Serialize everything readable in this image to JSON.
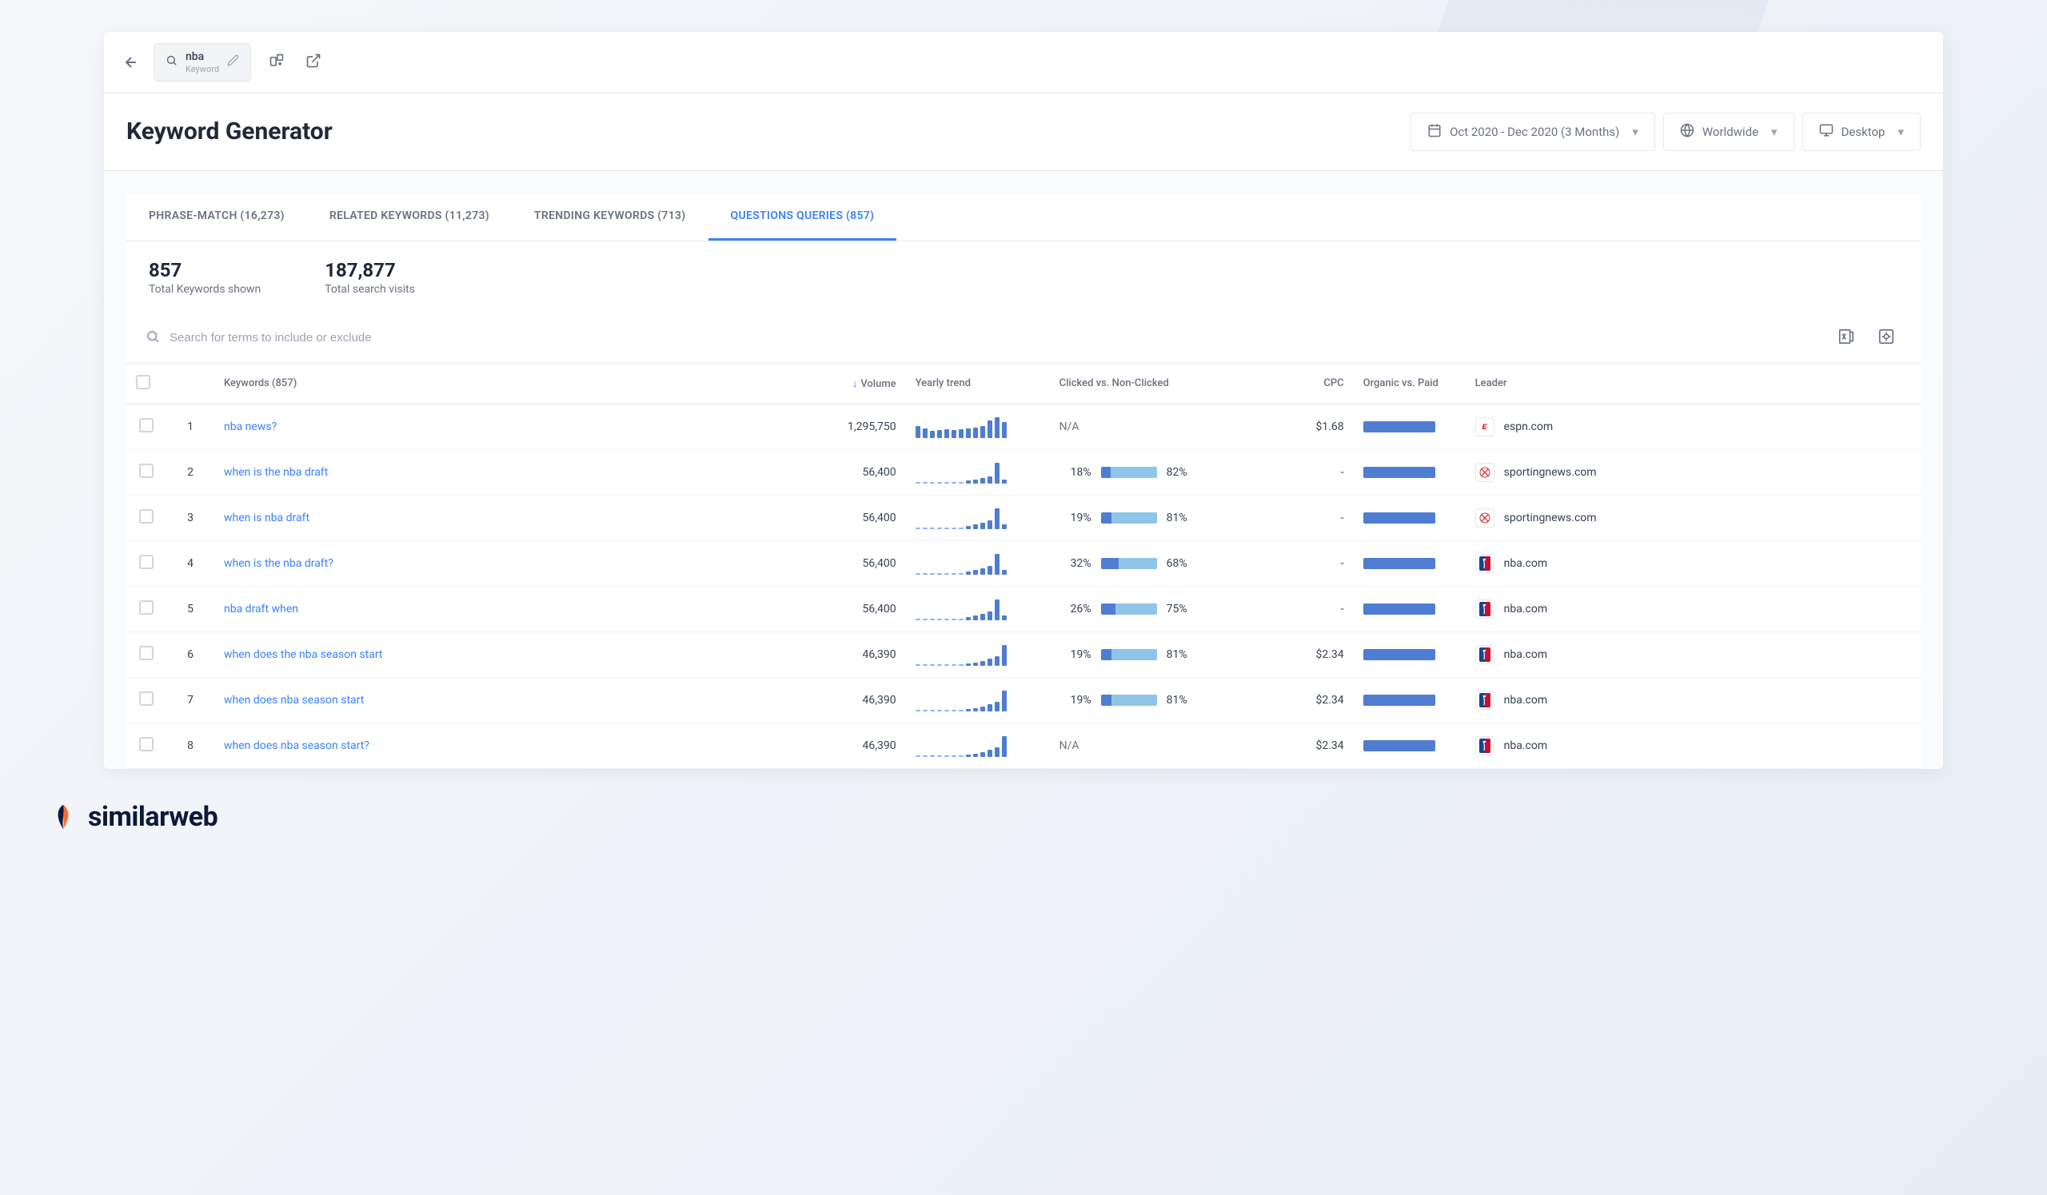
{
  "topbar": {
    "keyword_term": "nba",
    "keyword_type": "Keyword"
  },
  "header": {
    "title": "Keyword Generator",
    "date_range": "Oct 2020 - Dec 2020 (3 Months)",
    "region": "Worldwide",
    "device": "Desktop"
  },
  "tabs": [
    {
      "label": "PHRASE-MATCH (16,273)",
      "active": false
    },
    {
      "label": "RELATED KEYWORDS (11,273)",
      "active": false
    },
    {
      "label": "TRENDING KEYWORDS (713)",
      "active": false
    },
    {
      "label": "QUESTIONS QUERIES (857)",
      "active": true
    }
  ],
  "summary": {
    "total_keywords_value": "857",
    "total_keywords_label": "Total Keywords shown",
    "total_visits_value": "187,877",
    "total_visits_label": "Total search visits"
  },
  "search": {
    "placeholder": "Search for terms to include or exclude"
  },
  "columns": {
    "keywords": "Keywords (857)",
    "volume": "Volume",
    "trend": "Yearly trend",
    "clicked": "Clicked vs. Non-Clicked",
    "cpc": "CPC",
    "organic": "Organic vs. Paid",
    "leader": "Leader"
  },
  "rows": [
    {
      "idx": "1",
      "keyword": "nba news?",
      "volume": "1,295,750",
      "trend": [
        14,
        11,
        8,
        9,
        10,
        9,
        10,
        11,
        12,
        14,
        20,
        24,
        18
      ],
      "clicked_left": null,
      "clicked_right": null,
      "clicked_na": "N/A",
      "cpc": "$1.68",
      "leader": "espn.com",
      "leader_type": "espn"
    },
    {
      "idx": "2",
      "keyword": "when is the nba draft",
      "volume": "56,400",
      "trend": [
        0,
        0,
        0,
        0,
        0,
        0,
        0,
        3,
        4,
        6,
        8,
        22,
        4
      ],
      "clicked_left": "18%",
      "clicked_right": "82%",
      "clicked_na": null,
      "cpc": "-",
      "leader": "sportingnews.com",
      "leader_type": "sn"
    },
    {
      "idx": "3",
      "keyword": "when is nba draft",
      "volume": "56,400",
      "trend": [
        0,
        0,
        0,
        0,
        0,
        0,
        0,
        3,
        5,
        7,
        9,
        22,
        5
      ],
      "clicked_left": "19%",
      "clicked_right": "81%",
      "clicked_na": null,
      "cpc": "-",
      "leader": "sportingnews.com",
      "leader_type": "sn"
    },
    {
      "idx": "4",
      "keyword": "when is the nba draft?",
      "volume": "56,400",
      "trend": [
        0,
        0,
        0,
        0,
        0,
        0,
        0,
        3,
        5,
        7,
        9,
        22,
        5
      ],
      "clicked_left": "32%",
      "clicked_right": "68%",
      "clicked_na": null,
      "cpc": "-",
      "leader": "nba.com",
      "leader_type": "nba"
    },
    {
      "idx": "5",
      "keyword": "nba draft when",
      "volume": "56,400",
      "trend": [
        0,
        0,
        0,
        0,
        0,
        0,
        0,
        3,
        5,
        7,
        9,
        22,
        5
      ],
      "clicked_left": "26%",
      "clicked_right": "75%",
      "clicked_na": null,
      "cpc": "-",
      "leader": "nba.com",
      "leader_type": "nba"
    },
    {
      "idx": "6",
      "keyword": "when does the nba season start",
      "volume": "46,390",
      "trend": [
        0,
        0,
        0,
        0,
        0,
        0,
        0,
        2,
        3,
        5,
        8,
        10,
        22
      ],
      "clicked_left": "19%",
      "clicked_right": "81%",
      "clicked_na": null,
      "cpc": "$2.34",
      "leader": "nba.com",
      "leader_type": "nba"
    },
    {
      "idx": "7",
      "keyword": "when does nba season start",
      "volume": "46,390",
      "trend": [
        0,
        0,
        0,
        0,
        0,
        0,
        0,
        2,
        3,
        5,
        8,
        10,
        22
      ],
      "clicked_left": "19%",
      "clicked_right": "81%",
      "clicked_na": null,
      "cpc": "$2.34",
      "leader": "nba.com",
      "leader_type": "nba"
    },
    {
      "idx": "8",
      "keyword": "when does nba season start?",
      "volume": "46,390",
      "trend": [
        0,
        0,
        0,
        0,
        0,
        0,
        0,
        2,
        3,
        5,
        8,
        10,
        22
      ],
      "clicked_left": null,
      "clicked_right": null,
      "clicked_na": "N/A",
      "cpc": "$2.34",
      "leader": "nba.com",
      "leader_type": "nba"
    }
  ],
  "footer": {
    "brand": "similarweb"
  }
}
